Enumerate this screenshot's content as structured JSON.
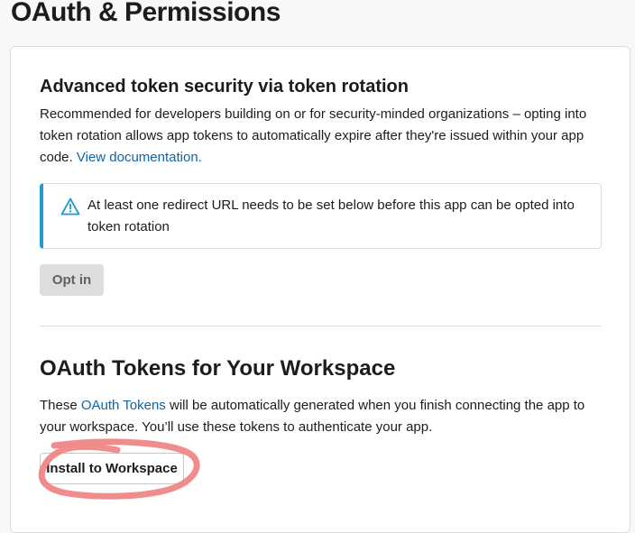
{
  "page": {
    "title": "OAuth & Permissions"
  },
  "token_rotation": {
    "title": "Advanced token security via token rotation",
    "description": "Recommended for developers building on or for security-minded organizations – opting into token rotation allows app tokens to automatically expire after they're issued within your app code.",
    "doc_link": "View documentation.",
    "alert": {
      "icon": "warning-triangle-icon",
      "text": "At least one redirect URL needs to be set below before this app can be opted into token rotation"
    },
    "opt_in_label": "Opt in"
  },
  "oauth_tokens": {
    "title": "OAuth Tokens for Your Workspace",
    "desc_before": "These ",
    "link": "OAuth Tokens",
    "desc_after": " will be automatically generated when you finish connecting the app to your workspace. You’ll use these tokens to authenticate your app.",
    "install_label": "Install to Workspace"
  },
  "colors": {
    "link": "#1264a3",
    "alert_accent": "#1d9bd1",
    "annotation": "#f08080"
  }
}
